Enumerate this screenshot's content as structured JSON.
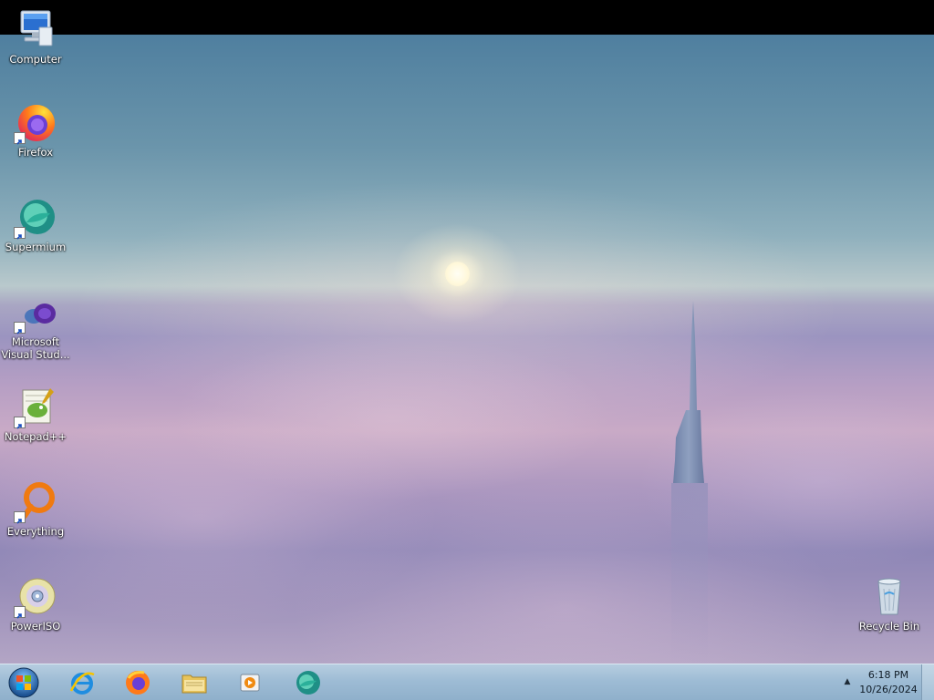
{
  "desktop": {
    "icons": [
      {
        "label": "Computer",
        "icon": "computer-icon"
      },
      {
        "label": "Firefox",
        "icon": "firefox-icon",
        "shortcut": true
      },
      {
        "label": "Supermium",
        "icon": "supermium-icon",
        "shortcut": true
      },
      {
        "label": "Microsoft\nVisual Stud...",
        "icon": "visual-studio-icon",
        "shortcut": true
      },
      {
        "label": "Notepad++",
        "icon": "notepad-plus-plus-icon",
        "shortcut": true
      },
      {
        "label": "Everything",
        "icon": "everything-search-icon",
        "shortcut": true
      },
      {
        "label": "PowerISO",
        "icon": "poweriso-icon",
        "shortcut": true
      },
      {
        "label": "Recycle Bin",
        "icon": "recycle-bin-icon"
      }
    ]
  },
  "taskbar": {
    "pinned": [
      {
        "name": "Internet Explorer",
        "icon": "internet-explorer-icon"
      },
      {
        "name": "Firefox",
        "icon": "firefox-icon"
      },
      {
        "name": "Windows Explorer",
        "icon": "folder-icon"
      },
      {
        "name": "Windows Media Player",
        "icon": "media-player-icon"
      },
      {
        "name": "Supermium",
        "icon": "supermium-icon"
      }
    ],
    "clock": {
      "time": "6:18 PM",
      "date": "10/26/2024"
    }
  },
  "colors": {
    "taskbar_top": "#b6cde0",
    "taskbar_bottom": "#8fb0cb",
    "sky_top": "#4f7f9f",
    "clouds": "#b79fc4"
  }
}
